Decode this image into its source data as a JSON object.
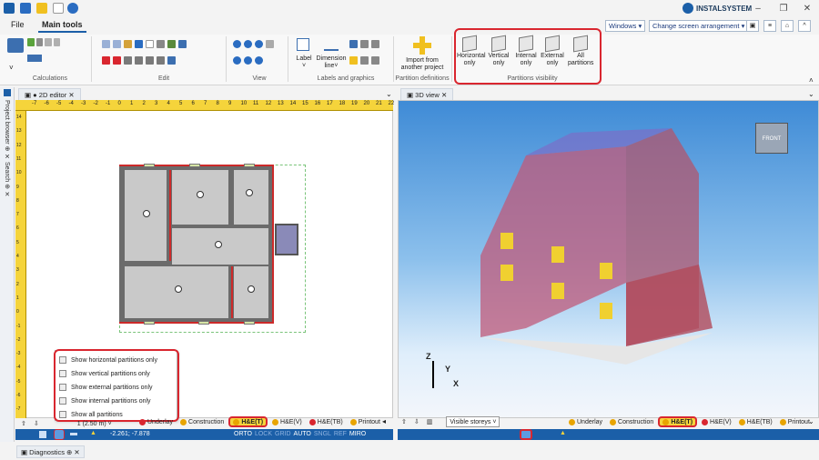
{
  "titlebar": {
    "brand": "INSTALSYSTEM",
    "icons": [
      "home-icon",
      "save-icon",
      "open-folder-icon",
      "new-document-icon",
      "undo-icon"
    ]
  },
  "menu": {
    "file": "File",
    "main_tools": "Main tools",
    "windows": "Windows",
    "change_arrangement": "Change screen arrangement"
  },
  "ribbon": {
    "groups": [
      "Calculations",
      "Edit",
      "View",
      "Labels and graphics",
      "Partition definitions",
      "Partitions visibility"
    ],
    "label_btn": "Label",
    "dimension_btn": "Dimension line",
    "import_btn": "Import from another project",
    "partitions": [
      {
        "label": "Horizontal only"
      },
      {
        "label": "Vertical only"
      },
      {
        "label": "Internal only"
      },
      {
        "label": "External only"
      },
      {
        "label": "All partitions"
      }
    ]
  },
  "panels": {
    "editor2d_tab": "2D editor",
    "view3d_tab": "3D view",
    "project_browser": "Project browser",
    "search": "Search",
    "diagnostics": "Diagnostics"
  },
  "ruler": {
    "h_ticks": [
      "-7",
      "-6",
      "-5",
      "-4",
      "-3",
      "-2",
      "-1",
      "0",
      "1",
      "2",
      "3",
      "4",
      "5",
      "6",
      "7",
      "8",
      "9",
      "10",
      "11",
      "12",
      "13",
      "14",
      "15",
      "16",
      "17",
      "18",
      "19",
      "20",
      "21",
      "22"
    ],
    "v_ticks": [
      "14",
      "13",
      "12",
      "11",
      "10",
      "9",
      "8",
      "7",
      "6",
      "5",
      "4",
      "3",
      "2",
      "1",
      "0",
      "-1",
      "-2",
      "-3",
      "-4",
      "-5",
      "-6",
      "-7"
    ]
  },
  "context_menu": [
    "Show horizontal partitions only",
    "Show vertical partitions only",
    "Show external partitions only",
    "Show internal partitions only",
    "Show all partitions"
  ],
  "tabs2d": {
    "level": "1 (2.50 m)",
    "items": [
      {
        "label": "Underlay",
        "color": "#d9262f",
        "selected": false
      },
      {
        "label": "Construction",
        "color": "#e8a400",
        "selected": false
      },
      {
        "label": "H&E(T)",
        "color": "#e8a400",
        "selected": true
      },
      {
        "label": "H&E(V)",
        "color": "#e8a400",
        "selected": false
      },
      {
        "label": "H&E(TB)",
        "color": "#d9262f",
        "selected": false
      },
      {
        "label": "Printout",
        "color": "#e8a400",
        "selected": false
      }
    ]
  },
  "tabs3d": {
    "visible_storeys": "Visible storeys",
    "items": [
      {
        "label": "Underlay",
        "color": "#e8a400",
        "selected": false
      },
      {
        "label": "Construction",
        "color": "#e8a400",
        "selected": false
      },
      {
        "label": "H&E(T)",
        "color": "#e8a400",
        "selected": true
      },
      {
        "label": "H&E(V)",
        "color": "#d9262f",
        "selected": false
      },
      {
        "label": "H&E(TB)",
        "color": "#e8a400",
        "selected": false
      },
      {
        "label": "Printout",
        "color": "#e8a400",
        "selected": false
      }
    ]
  },
  "status2d": {
    "coords": "-2.261; -7.878",
    "modes": [
      "ORTO",
      "LOCK",
      "GRID",
      "AUTO",
      "SNGL",
      "REF",
      "MIRO"
    ]
  },
  "axes": {
    "x": "X",
    "y": "Y",
    "z": "Z"
  },
  "viewcube": "FRONT"
}
